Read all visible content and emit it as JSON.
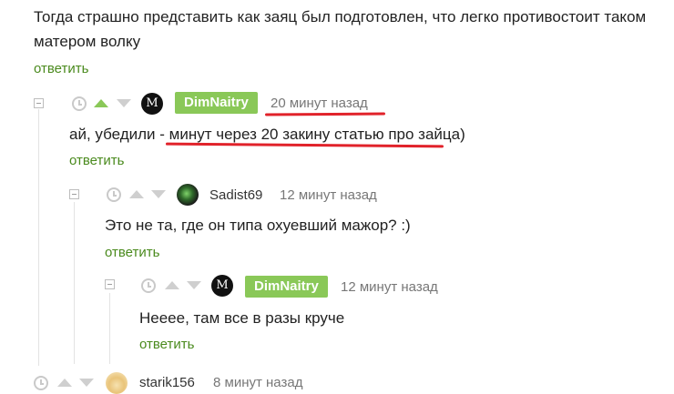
{
  "top_comment": {
    "text_line1": "Тогда страшно представить как заяц был подготовлен, что легко противостоит таком",
    "text_line2": "матером волку",
    "reply_label": "ответить"
  },
  "comment1": {
    "author": "DimNaitry",
    "author_avatar_letter": "M",
    "time": "20 минут назад",
    "text_part1": "ай, убедили - ",
    "text_part2": "минут через 20 закину статью про зайца",
    "text_part3": ")",
    "reply_label": "ответить"
  },
  "comment2": {
    "author": "Sadist69",
    "time": "12 минут назад",
    "text": "Это не та, где он типа охуевший мажор? :)",
    "reply_label": "ответить"
  },
  "comment3": {
    "author": "DimNaitry",
    "author_avatar_letter": "M",
    "time": "12 минут назад",
    "text": "Нееее, там все в разы круче",
    "reply_label": "ответить"
  },
  "comment4": {
    "author": "starik156",
    "time": "8 минут назад"
  },
  "colors": {
    "accent_green": "#8ac858",
    "reply_green": "#4a8a1d",
    "annotation_red": "#e1222a"
  }
}
